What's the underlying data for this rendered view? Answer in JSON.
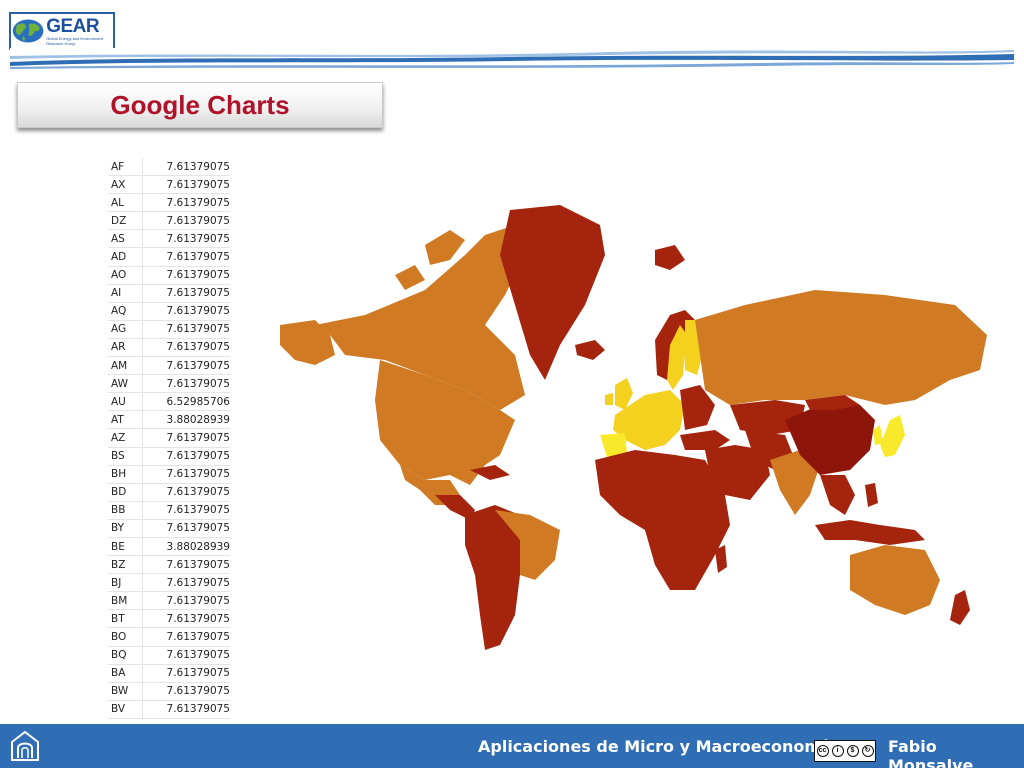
{
  "header": {
    "logo_text": "GEAR",
    "logo_subtitle": "Global Energy and Environment Research Group"
  },
  "title": "Google Charts",
  "table": {
    "rows": [
      {
        "code": "AF",
        "value": "7.61379075"
      },
      {
        "code": "AX",
        "value": "7.61379075"
      },
      {
        "code": "AL",
        "value": "7.61379075"
      },
      {
        "code": "DZ",
        "value": "7.61379075"
      },
      {
        "code": "AS",
        "value": "7.61379075"
      },
      {
        "code": "AD",
        "value": "7.61379075"
      },
      {
        "code": "AO",
        "value": "7.61379075"
      },
      {
        "code": "AI",
        "value": "7.61379075"
      },
      {
        "code": "AQ",
        "value": "7.61379075"
      },
      {
        "code": "AG",
        "value": "7.61379075"
      },
      {
        "code": "AR",
        "value": "7.61379075"
      },
      {
        "code": "AM",
        "value": "7.61379075"
      },
      {
        "code": "AW",
        "value": "7.61379075"
      },
      {
        "code": "AU",
        "value": "6.52985706"
      },
      {
        "code": "AT",
        "value": "3.88028939"
      },
      {
        "code": "AZ",
        "value": "7.61379075"
      },
      {
        "code": "BS",
        "value": "7.61379075"
      },
      {
        "code": "BH",
        "value": "7.61379075"
      },
      {
        "code": "BD",
        "value": "7.61379075"
      },
      {
        "code": "BB",
        "value": "7.61379075"
      },
      {
        "code": "BY",
        "value": "7.61379075"
      },
      {
        "code": "BE",
        "value": "3.88028939"
      },
      {
        "code": "BZ",
        "value": "7.61379075"
      },
      {
        "code": "BJ",
        "value": "7.61379075"
      },
      {
        "code": "BM",
        "value": "7.61379075"
      },
      {
        "code": "BT",
        "value": "7.61379075"
      },
      {
        "code": "BO",
        "value": "7.61379075"
      },
      {
        "code": "BQ",
        "value": "7.61379075"
      },
      {
        "code": "BA",
        "value": "7.61379075"
      },
      {
        "code": "BW",
        "value": "7.61379075"
      },
      {
        "code": "BV",
        "value": "7.61379075"
      }
    ]
  },
  "map": {
    "colors": {
      "dark_red": "#a5240e",
      "deep_red": "#8d150a",
      "orange": "#d07a24",
      "yellow": "#f4d11e",
      "bright_yellow": "#f8ea2a"
    }
  },
  "footer": {
    "course": "Aplicaciones de Micro y Macroeconomía",
    "license_badge": "cc by nc sa",
    "author": "Fabio Monsalve",
    "background_color": "#2f6eb5"
  }
}
